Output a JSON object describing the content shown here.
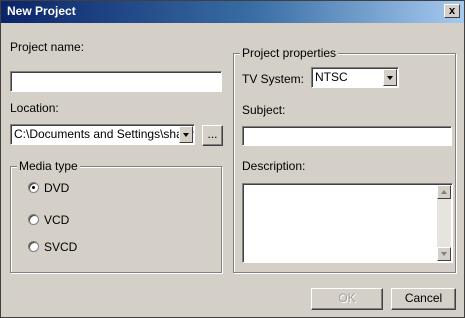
{
  "window": {
    "title": "New Project",
    "close_label": "x"
  },
  "left": {
    "project_name_label": "Project name:",
    "project_name_value": "",
    "location_label": "Location:",
    "location_value": "C:\\Documents and Settings\\sharm",
    "browse_label": "...",
    "media_type": {
      "legend": "Media type",
      "options": [
        {
          "label": "DVD",
          "selected": true
        },
        {
          "label": "VCD",
          "selected": false
        },
        {
          "label": "SVCD",
          "selected": false
        }
      ]
    }
  },
  "right": {
    "legend": "Project properties",
    "tv_system_label": "TV System:",
    "tv_system_value": "NTSC",
    "subject_label": "Subject:",
    "subject_value": "",
    "description_label": "Description:",
    "description_value": ""
  },
  "buttons": {
    "ok_label": "OK",
    "ok_enabled": false,
    "cancel_label": "Cancel"
  },
  "icons": {
    "close": "close-icon",
    "dropdown": "chevron-down-icon",
    "scroll_up": "scroll-up-arrow-icon",
    "scroll_down": "scroll-down-arrow-icon"
  }
}
